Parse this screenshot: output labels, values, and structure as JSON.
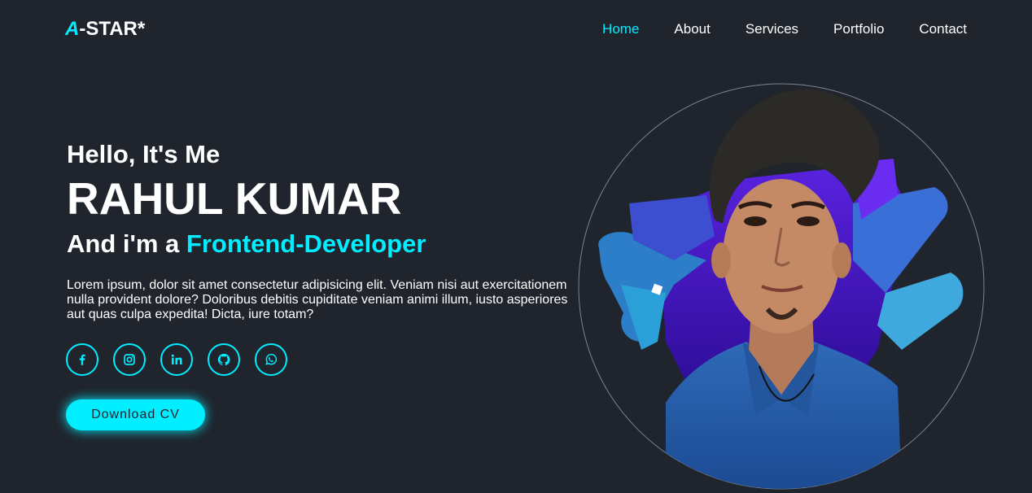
{
  "header": {
    "logo": {
      "prefix": "A",
      "suffix": "-STAR*"
    },
    "nav": [
      {
        "label": "Home",
        "active": true
      },
      {
        "label": "About",
        "active": false
      },
      {
        "label": "Services",
        "active": false
      },
      {
        "label": "Portfolio",
        "active": false
      },
      {
        "label": "Contact",
        "active": false
      }
    ]
  },
  "hero": {
    "greeting": "Hello, It's Me",
    "name": "RAHUL KUMAR",
    "role_prefix": "And i'm a ",
    "role": "Frontend-Developer",
    "description": "Lorem ipsum, dolor sit amet consectetur adipisicing elit. Veniam nisi aut exercitationem nulla provident dolore? Doloribus debitis cupiditate veniam animi illum, iusto asperiores aut quas culpa expedita! Dicta, iure totam?",
    "socials": [
      {
        "icon": "facebook-icon"
      },
      {
        "icon": "instagram-icon"
      },
      {
        "icon": "linkedin-icon"
      },
      {
        "icon": "github-icon"
      },
      {
        "icon": "whatsapp-icon"
      }
    ],
    "cta_label": "Download CV"
  },
  "colors": {
    "background": "#1f242d",
    "accent": "#00eeff",
    "text": "#ffffff"
  }
}
